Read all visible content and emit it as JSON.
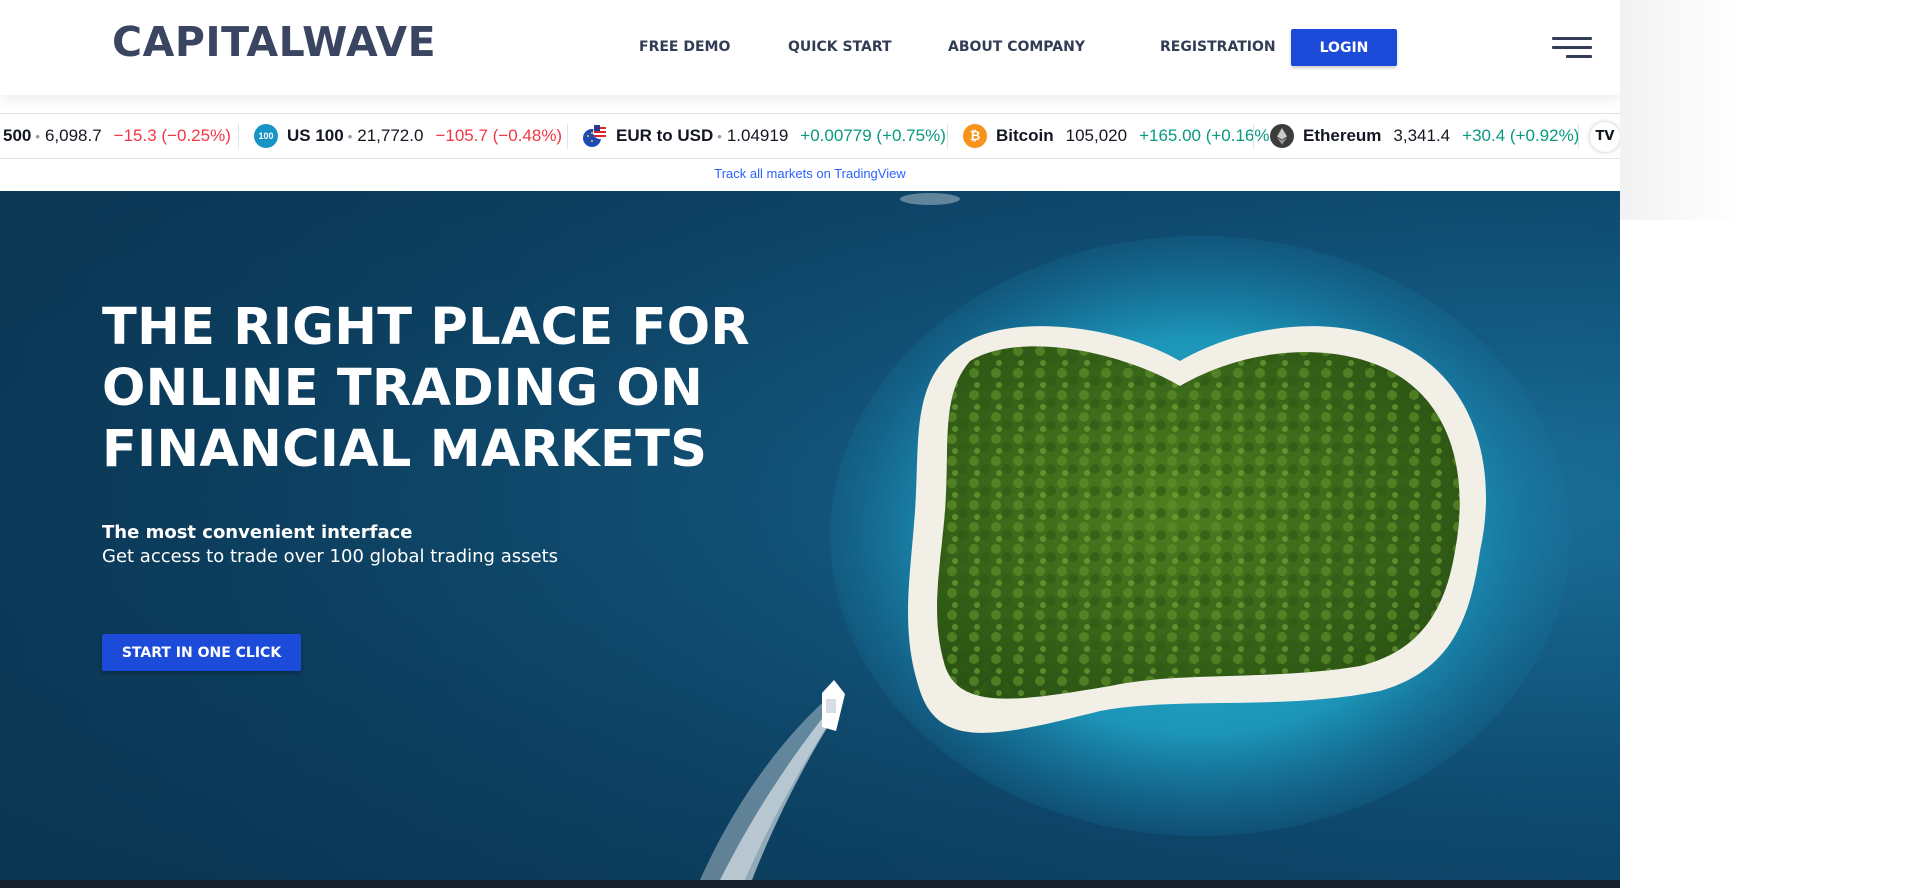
{
  "header": {
    "logo": "CAPITALWAVE",
    "nav": {
      "free_demo": "FREE DEMO",
      "quick_start": "QUICK START",
      "about_company": "ABOUT COMPANY",
      "registration": "REGISTRATION"
    },
    "login_label": "LOGIN",
    "menu_icon": "hamburger-menu-icon"
  },
  "ticker": {
    "items": [
      {
        "symbol": "500",
        "value": "6,098.7",
        "change": "−15.3 (−0.25%)",
        "direction": "down"
      },
      {
        "symbol": "US 100",
        "icon_text": "100",
        "value": "21,772.0",
        "change": "−105.7 (−0.48%)",
        "direction": "down",
        "icon_color": "#1594c5"
      },
      {
        "symbol": "EUR to USD",
        "value": "1.04919",
        "change": "+0.00779 (+0.75%)",
        "direction": "up",
        "icon": "eu-us-flag-icon"
      },
      {
        "symbol": "Bitcoin",
        "value": "105,020",
        "change": "+165.00 (+0.16%",
        "direction": "mixed",
        "icon": "bitcoin-icon",
        "icon_color": "#f7931a"
      },
      {
        "symbol": "Ethereum",
        "value": "3,341.4",
        "change": "+30.4 (+0.92%)",
        "direction": "up",
        "icon": "ethereum-icon",
        "icon_color": "#3c3c3d"
      }
    ],
    "tv_logo": "TV",
    "track_link": "Track all markets on TradingView"
  },
  "hero": {
    "title_lines": [
      "THE RIGHT PLACE FOR",
      "ONLINE TRADING ON",
      "FINANCIAL MARKETS"
    ],
    "subtitle_strong": "The most convenient interface",
    "subtitle": "Get access to trade over 100 global trading assets",
    "cta_label": "START IN ONE CLICK"
  },
  "colors": {
    "brand_text": "#3a4562",
    "accent_blue": "#1c4bd9",
    "ticker_negative": "#f23645",
    "ticker_positive": "#089981",
    "link_blue": "#2962ff",
    "ocean_deep": "#0e4a6f"
  }
}
